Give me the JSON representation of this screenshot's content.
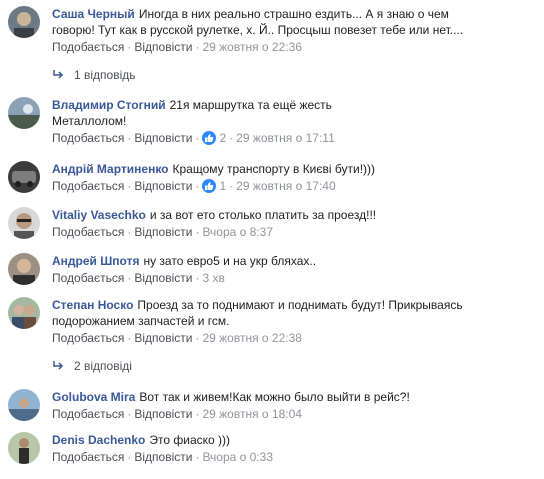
{
  "common": {
    "like": "Подобається",
    "reply": "Відповісти",
    "dot": "·"
  },
  "comments": [
    {
      "author": "Саша Черный",
      "text": [
        "Иногда в них реально страшно ездить... А я знаю о чем",
        "говорю! Тут как в русской рулетке, х. Й.. Просцыш повезет тебе или нет...."
      ],
      "time": "29 жовтня о 22:36",
      "reactions": "",
      "replies": "1 відповідь"
    },
    {
      "author": "Владимир Стогний",
      "text": [
        "21я маршрутка та ещё жесть",
        "Металлолом!"
      ],
      "time": "29 жовтня о 17:11",
      "reactions": "2",
      "replies": ""
    },
    {
      "author": "Андрій Мартиненко",
      "text": [
        "Кращому транспорту в Києві бути!)))"
      ],
      "time": "29 жовтня о 17:40",
      "reactions": "1",
      "replies": ""
    },
    {
      "author": "Vitaliy Vasechko",
      "text": [
        "и за вот ето столько платить за проезд!!!"
      ],
      "time": "Вчора о 8:37",
      "reactions": "",
      "replies": ""
    },
    {
      "author": "Андрей Шпотя",
      "text": [
        "ну зато евро5 и на укр бляхах.."
      ],
      "time": "3 хв",
      "reactions": "",
      "replies": ""
    },
    {
      "author": "Степан Носко",
      "text": [
        "Проезд за то поднимают и поднимать будут! Прикрываясь",
        "подорожанием запчастей и гсм."
      ],
      "time": "29 жовтня о 22:38",
      "reactions": "",
      "replies": "2 відповіді"
    },
    {
      "author": "Golubova Mira",
      "text": [
        "Вот так и живем!Как можно было выйти в рейс?!"
      ],
      "time": "29 жовтня о 18:04",
      "reactions": "",
      "replies": ""
    },
    {
      "author": "Denis Dachenko",
      "text": [
        "Это фиаско )))"
      ],
      "time": "Вчора о 0:33",
      "reactions": "",
      "replies": ""
    }
  ],
  "colors": {
    "author": "#385898",
    "link": "#4b4f56",
    "meta": "#90949c",
    "reaction": "#2d88ff"
  }
}
